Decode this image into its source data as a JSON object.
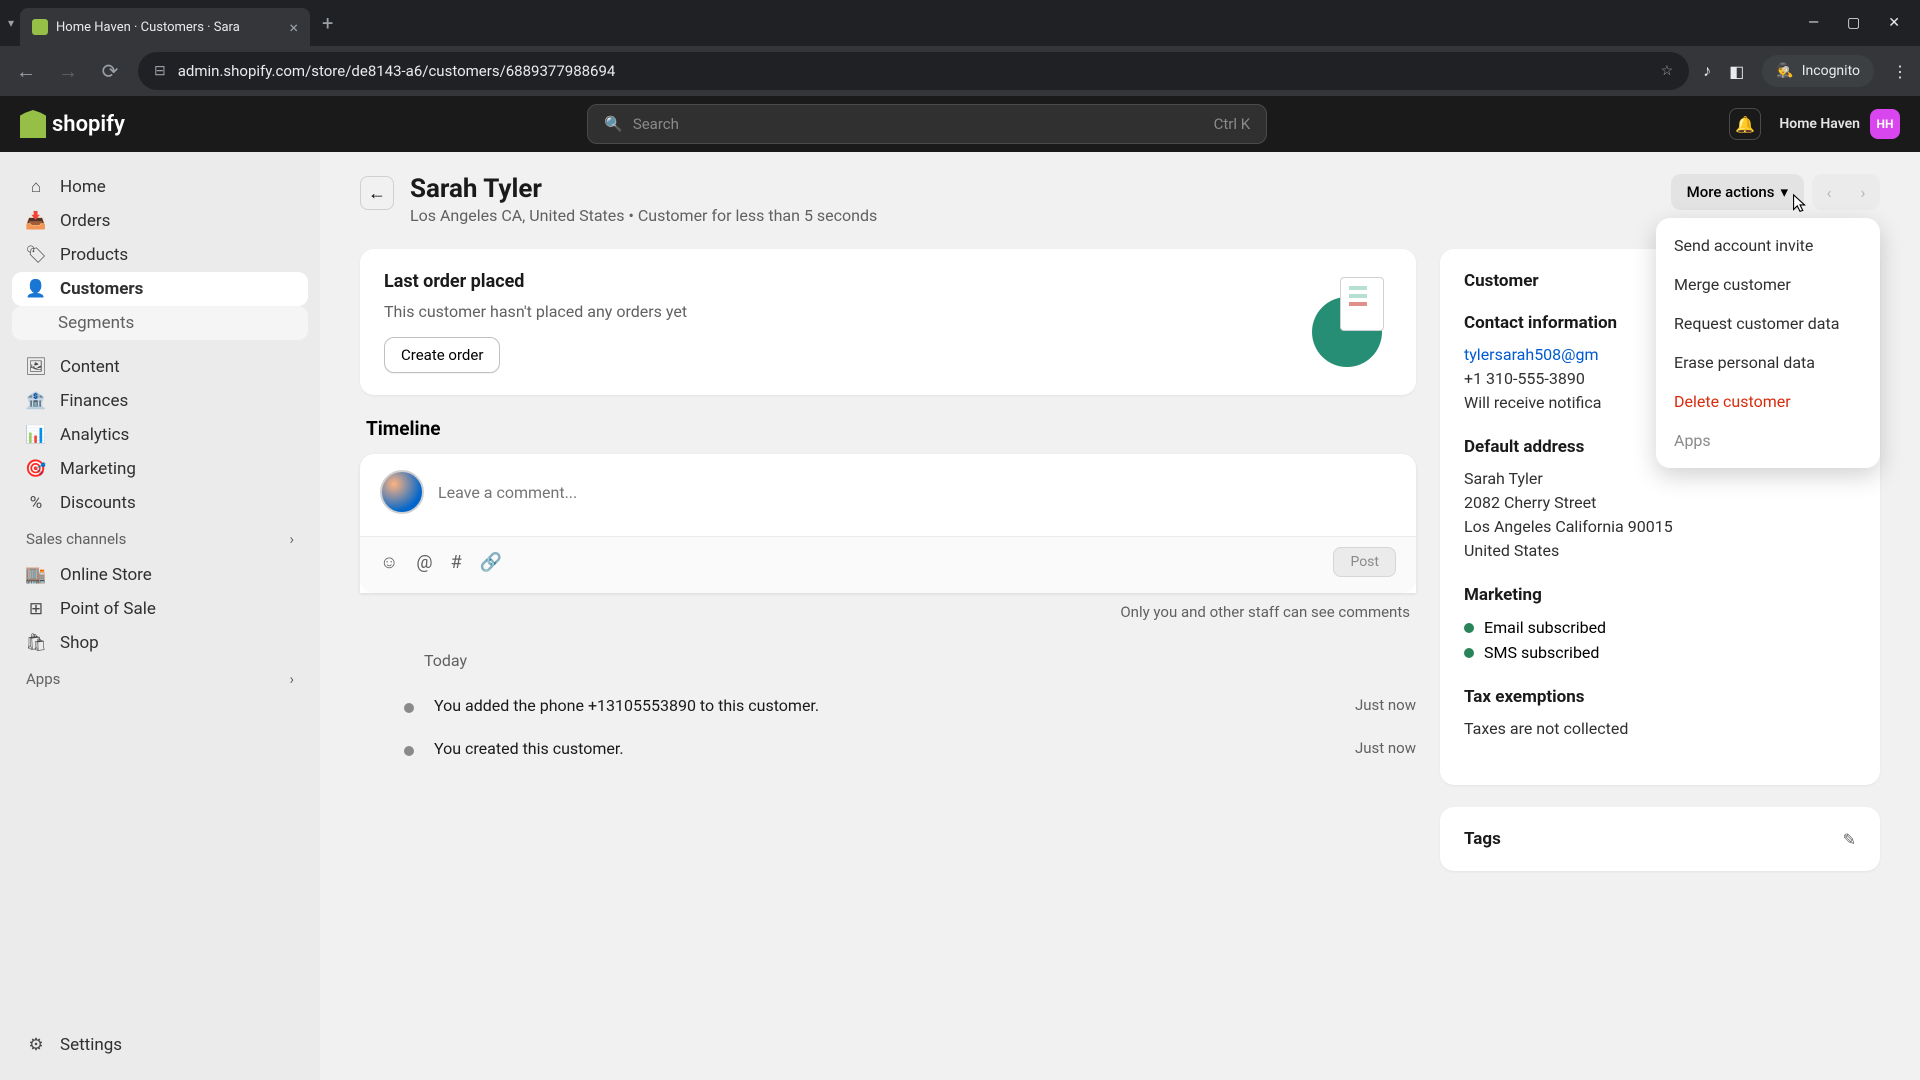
{
  "browser": {
    "tab_title": "Home Haven · Customers · Sara",
    "url": "admin.shopify.com/store/de8143-a6/customers/6889377988694",
    "incognito_label": "Incognito"
  },
  "header": {
    "logo_text": "shopify",
    "search_placeholder": "Search",
    "search_shortcut": "Ctrl K",
    "store_name": "Home Haven",
    "store_initials": "HH"
  },
  "sidebar": {
    "items": [
      {
        "label": "Home"
      },
      {
        "label": "Orders"
      },
      {
        "label": "Products"
      },
      {
        "label": "Customers"
      },
      {
        "label": "Content"
      },
      {
        "label": "Finances"
      },
      {
        "label": "Analytics"
      },
      {
        "label": "Marketing"
      },
      {
        "label": "Discounts"
      }
    ],
    "customers_sub": "Segments",
    "sales_section": "Sales channels",
    "sales_items": [
      {
        "label": "Online Store"
      },
      {
        "label": "Point of Sale"
      },
      {
        "label": "Shop"
      }
    ],
    "apps_section": "Apps",
    "settings": "Settings"
  },
  "page": {
    "title": "Sarah Tyler",
    "subtitle": "Los Angeles CA, United States • Customer for less than 5 seconds",
    "more_actions": "More actions"
  },
  "dropdown": {
    "send_invite": "Send account invite",
    "merge": "Merge customer",
    "request_data": "Request customer data",
    "erase_data": "Erase personal data",
    "delete": "Delete customer",
    "apps": "Apps"
  },
  "order_card": {
    "title": "Last order placed",
    "text": "This customer hasn't placed any orders yet",
    "button": "Create order"
  },
  "timeline": {
    "title": "Timeline",
    "comment_placeholder": "Leave a comment...",
    "post": "Post",
    "visibility_note": "Only you and other staff can see comments",
    "day_label": "Today",
    "items": [
      {
        "text": "You added the phone +13105553890 to this customer.",
        "time": "Just now"
      },
      {
        "text": "You created this customer.",
        "time": "Just now"
      }
    ]
  },
  "customer_panel": {
    "title": "Customer",
    "contact_title": "Contact information",
    "email": "tylersarah508@gm",
    "phone": "+1 310-555-3890",
    "notify": "Will receive notifica",
    "address_title": "Default address",
    "addr_name": "Sarah Tyler",
    "addr_street": "2082 Cherry Street",
    "addr_city": "Los Angeles California 90015",
    "addr_country": "United States",
    "marketing_title": "Marketing",
    "email_sub": "Email subscribed",
    "sms_sub": "SMS subscribed",
    "tax_title": "Tax exemptions",
    "tax_text": "Taxes are not collected",
    "tags_title": "Tags"
  }
}
